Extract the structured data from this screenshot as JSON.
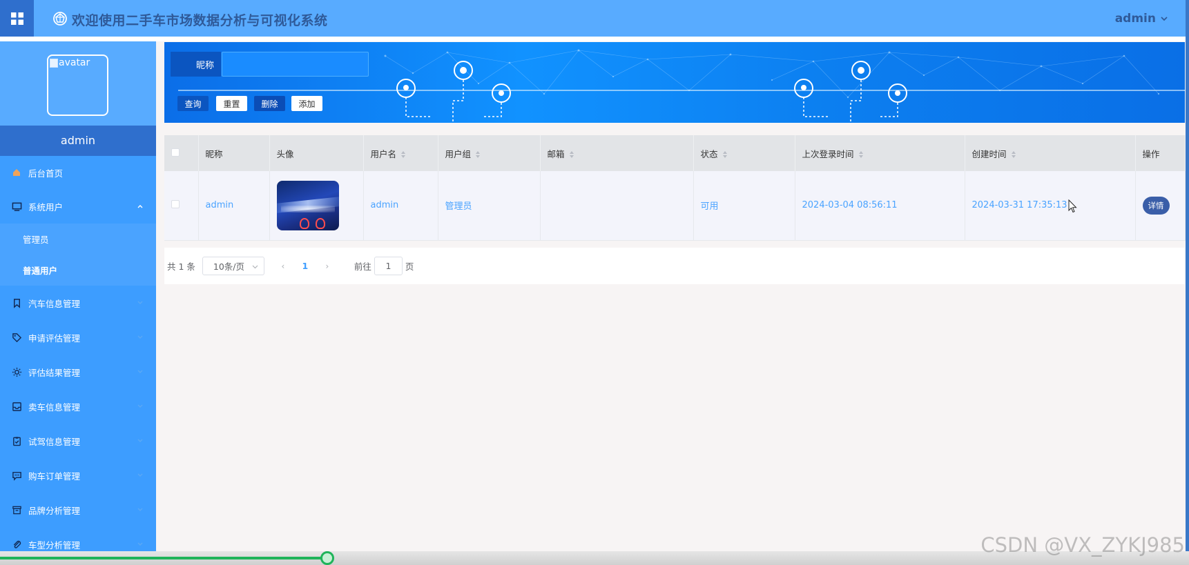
{
  "app": {
    "title": "欢迎使用二手车市场数据分析与可视化系统",
    "user": "admin",
    "grid_icon": "grid-icon",
    "logo_icon": "globe-logo-icon"
  },
  "sidebar": {
    "avatar_alt": "avatar",
    "username": "admin",
    "items": [
      {
        "label": "后台首页",
        "icon": "home-icon"
      },
      {
        "label": "系统用户",
        "icon": "monitor-icon",
        "expanded": true,
        "children": [
          {
            "label": "管理员"
          },
          {
            "label": "普通用户",
            "active": true
          }
        ]
      },
      {
        "label": "汽车信息管理",
        "icon": "bookmark-icon"
      },
      {
        "label": "申请评估管理",
        "icon": "tag-icon"
      },
      {
        "label": "评估结果管理",
        "icon": "sun-icon"
      },
      {
        "label": "卖车信息管理",
        "icon": "inbox-icon"
      },
      {
        "label": "试驾信息管理",
        "icon": "clipboard-icon"
      },
      {
        "label": "购车订单管理",
        "icon": "chat-icon"
      },
      {
        "label": "品牌分析管理",
        "icon": "box-icon"
      },
      {
        "label": "车型分析管理",
        "icon": "paperclip-icon"
      }
    ]
  },
  "search": {
    "label": "昵称",
    "value": "",
    "buttons": {
      "query": "查询",
      "reset": "重置",
      "delete": "删除",
      "add": "添加"
    }
  },
  "table": {
    "headers": [
      "昵称",
      "头像",
      "用户名",
      "用户组",
      "邮箱",
      "状态",
      "上次登录时间",
      "创建时间",
      "操作"
    ],
    "rows": [
      {
        "nickname": "admin",
        "username": "admin",
        "group": "管理员",
        "email": "",
        "status": "可用",
        "last_login": "2024-03-04 08:56:11",
        "created": "2024-03-31 17:35:13",
        "action": "详情"
      }
    ]
  },
  "pagination": {
    "total": "共 1 条",
    "page_size": "10条/页",
    "current_page": "1",
    "goto_prefix": "前往",
    "goto_value": "1",
    "goto_suffix": "页"
  },
  "video_progress": 0.275,
  "watermark": "CSDN @VX_ZYKJ985",
  "colors": {
    "topbar": "#58abff",
    "sidebar": "#3d9dff",
    "accent": "#409eff",
    "dark": "#2f6fcd"
  }
}
